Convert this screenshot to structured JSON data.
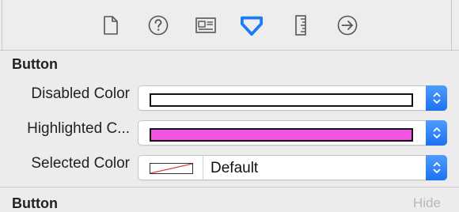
{
  "toolbar": {
    "icons": [
      {
        "name": "file-inspector-icon",
        "color": "#555555"
      },
      {
        "name": "quick-help-icon",
        "color": "#555555"
      },
      {
        "name": "identity-inspector-icon",
        "color": "#555555"
      },
      {
        "name": "attributes-inspector-icon",
        "color": "#1a7cf5",
        "selected": true
      },
      {
        "name": "size-inspector-icon",
        "color": "#555555"
      },
      {
        "name": "connections-inspector-icon",
        "color": "#555555"
      }
    ]
  },
  "section": {
    "title": "Button",
    "rows": [
      {
        "label": "Disabled Color",
        "swatch_color": "#ffffff"
      },
      {
        "label": "Highlighted C...",
        "swatch_color": "#f054e0"
      },
      {
        "label": "Selected Color",
        "value": "Default"
      }
    ]
  },
  "section2": {
    "title": "Button",
    "hide_label": "Hide"
  },
  "colors": {
    "accent": "#1a7cf5",
    "stepper": "#2b82f5",
    "highlight_swatch": "#f054e0",
    "no_color_line": "#e0362c"
  }
}
